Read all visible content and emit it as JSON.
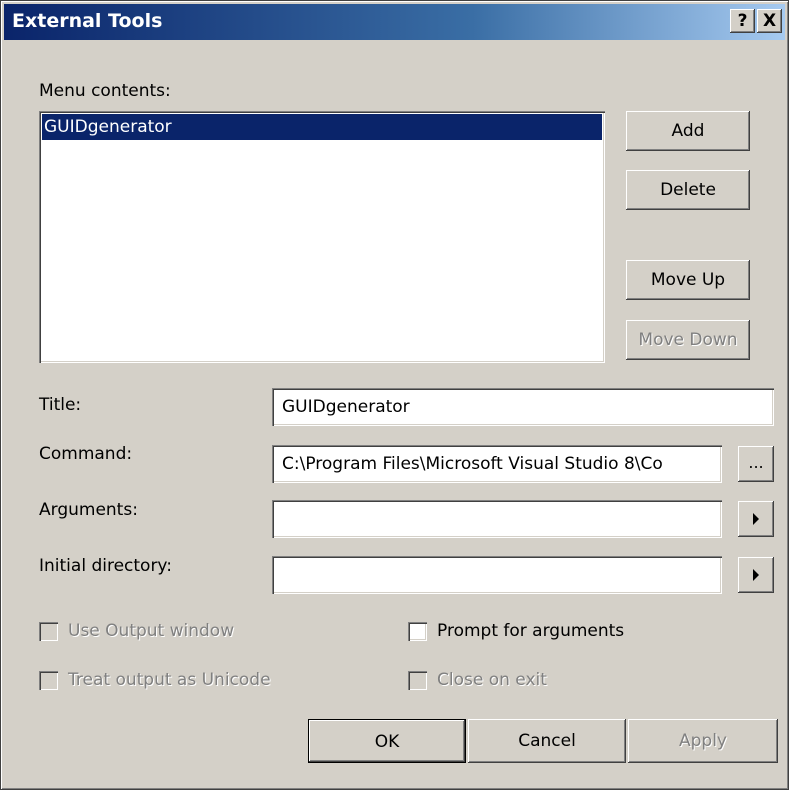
{
  "window": {
    "title": "External Tools",
    "help_label": "?",
    "close_label": "X"
  },
  "menu_contents": {
    "label": "Menu contents:",
    "items": [
      "GUIDgenerator"
    ],
    "selected_index": 0
  },
  "side_buttons": {
    "add": "Add",
    "delete": "Delete",
    "move_up": "Move Up",
    "move_down": "Move Down"
  },
  "fields": {
    "title_label": "Title:",
    "title_value": "GUIDgenerator",
    "command_label": "Command:",
    "command_value": "C:\\Program Files\\Microsoft Visual Studio 8\\Co",
    "browse_label": "...",
    "arguments_label": "Arguments:",
    "arguments_value": "",
    "initial_directory_label": "Initial directory:",
    "initial_directory_value": ""
  },
  "options": {
    "use_output_window": "Use Output window",
    "treat_output_unicode": "Treat output as Unicode",
    "prompt_for_arguments": "Prompt for arguments",
    "close_on_exit": "Close on exit"
  },
  "footer": {
    "ok": "OK",
    "cancel": "Cancel",
    "apply": "Apply"
  },
  "icons": {
    "help": "help-icon",
    "close": "close-icon",
    "arguments_menu": "right-arrow-icon",
    "initial_directory_menu": "right-arrow-icon"
  },
  "colors": {
    "titlebar": "#0a246a",
    "face": "#d4d0c8",
    "selection": "#0a246a",
    "disabled_text": "#808080"
  }
}
